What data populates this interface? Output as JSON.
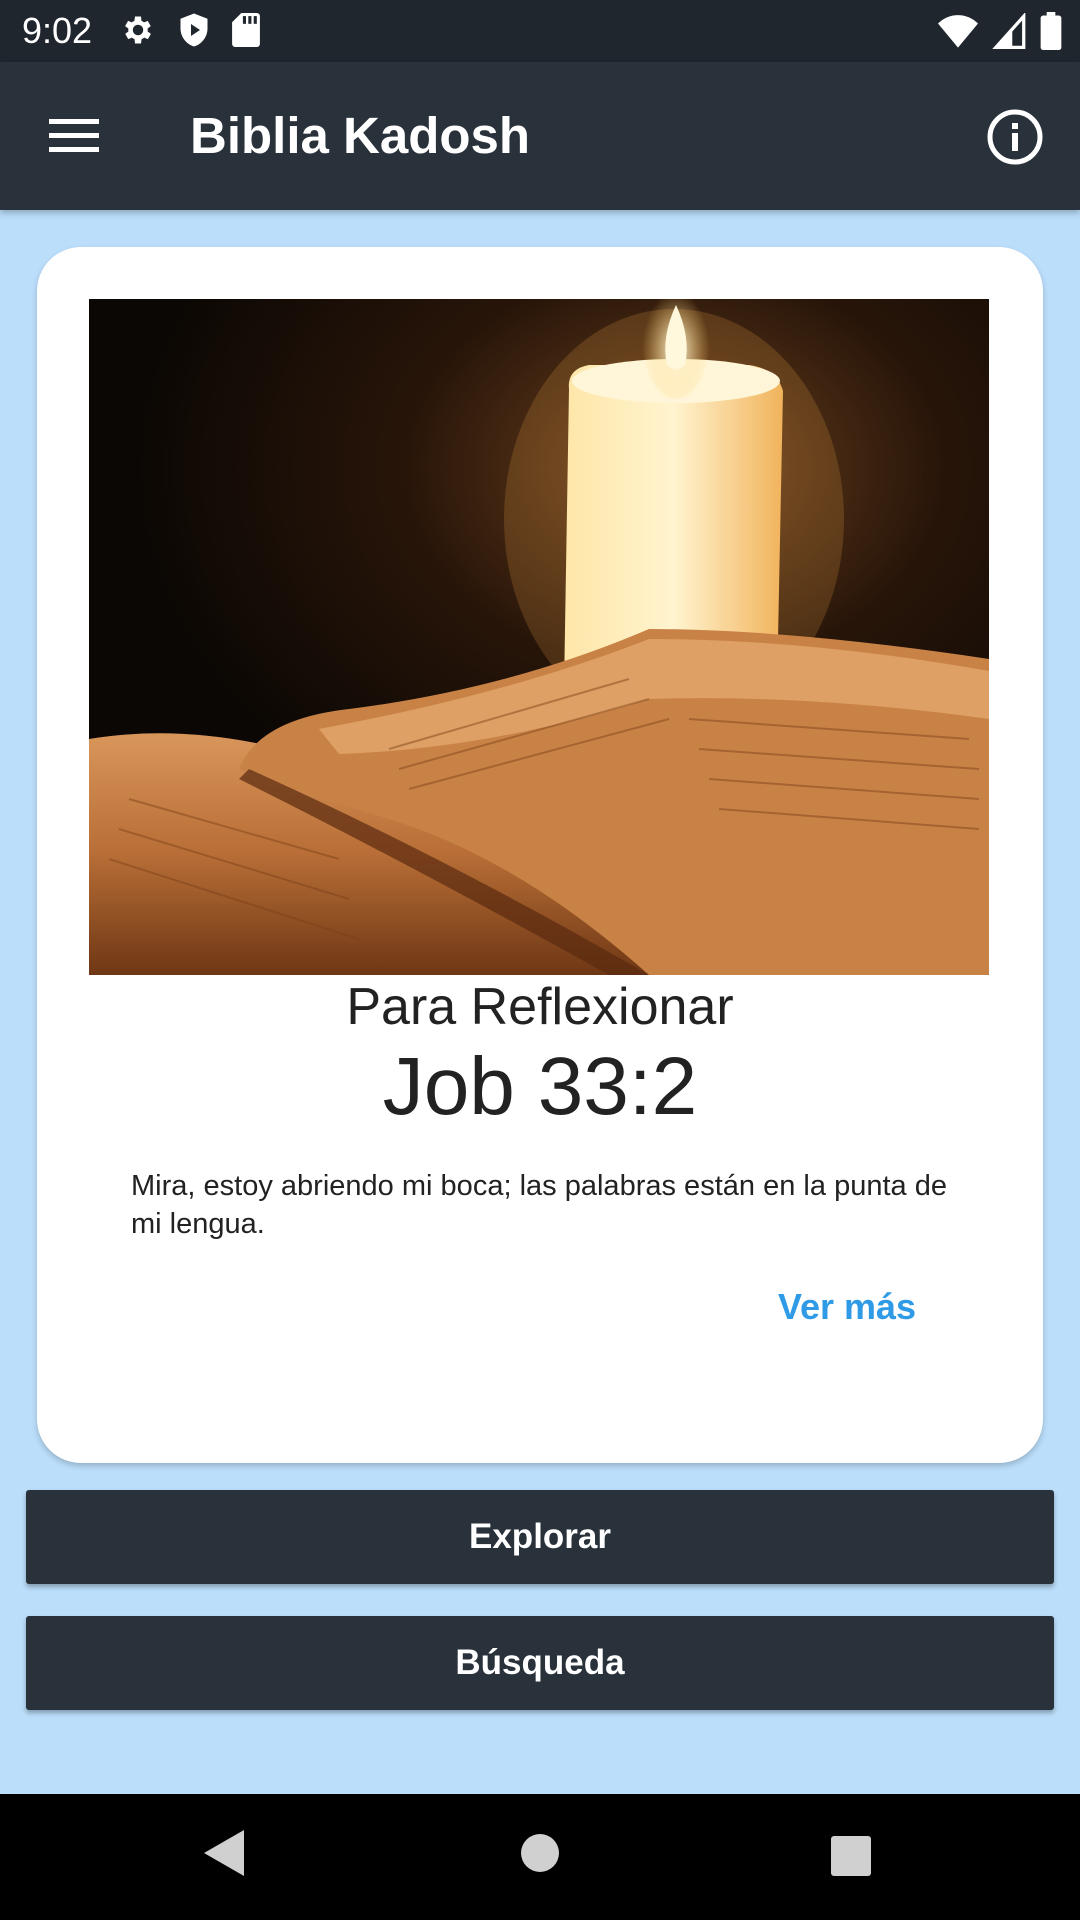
{
  "status_bar": {
    "time": "9:02",
    "left_icons": [
      "gear-icon",
      "shield-play-icon",
      "sd-card-icon"
    ],
    "right_icons": [
      "wifi-icon",
      "cell-signal-icon",
      "battery-icon"
    ]
  },
  "app_bar": {
    "title": "Biblia Kadosh",
    "menu_icon": "hamburger-menu-icon",
    "info_icon": "info-icon"
  },
  "card": {
    "image_alt": "candle-and-open-bible",
    "subtitle": "Para Reflexionar",
    "reference": "Job 33:2",
    "verse": "Mira, estoy abriendo mi boca; las palabras están en la punta de mi lengua.",
    "more_link": "Ver más"
  },
  "buttons": {
    "explore": "Explorar",
    "search": "Búsqueda"
  },
  "nav_bar": {
    "icons": [
      "back-icon",
      "home-icon",
      "recents-icon"
    ]
  },
  "colors": {
    "app_bar": "#29313a",
    "status_bar": "#1f262d",
    "background": "#bbdefb",
    "link": "#2f9be6"
  }
}
